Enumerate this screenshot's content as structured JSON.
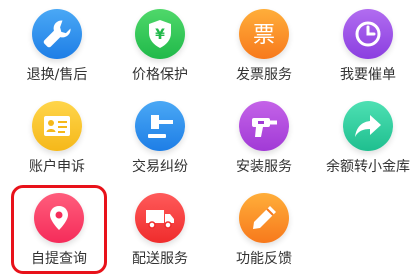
{
  "tiles": [
    {
      "label": "退换/售后",
      "icon": "wrench-icon",
      "color_top": "#4aa8f5",
      "color_bottom": "#1e7ee6"
    },
    {
      "label": "价格保护",
      "icon": "yuan-shield-icon",
      "color_top": "#4fd86a",
      "color_bottom": "#20b94a"
    },
    {
      "label": "发票服务",
      "icon": "invoice-icon",
      "color_top": "#ffae3a",
      "color_bottom": "#f7791c"
    },
    {
      "label": "我要催单",
      "icon": "clock-icon",
      "color_top": "#b16cf0",
      "color_bottom": "#8b3fe0"
    },
    {
      "label": "账户申诉",
      "icon": "id-card-icon",
      "color_top": "#ffd54a",
      "color_bottom": "#f5b81a"
    },
    {
      "label": "交易纠纷",
      "icon": "gavel-icon",
      "color_top": "#4aa8f5",
      "color_bottom": "#1e7ee6"
    },
    {
      "label": "安装服务",
      "icon": "drill-icon",
      "color_top": "#c463e8",
      "color_bottom": "#a13ad6"
    },
    {
      "label": "余额转小金库",
      "icon": "share-arrow-icon",
      "color_top": "#4ee0b3",
      "color_bottom": "#1fbf8f"
    },
    {
      "label": "自提查询",
      "icon": "location-pin-icon",
      "color_top": "#ff5d7c",
      "color_bottom": "#f52c5a"
    },
    {
      "label": "配送服务",
      "icon": "delivery-truck-icon",
      "color_top": "#ff5a5a",
      "color_bottom": "#ef2c2c"
    },
    {
      "label": "功能反馈",
      "icon": "pencil-icon",
      "color_top": "#ffae3a",
      "color_bottom": "#f7791c"
    }
  ],
  "invoice_glyph": "票",
  "yuan_glyph": "¥",
  "highlight_color": "#e8121a"
}
